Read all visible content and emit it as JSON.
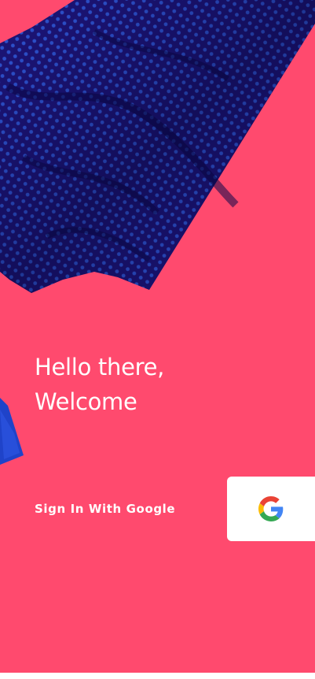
{
  "welcome": {
    "line1": "Hello there,",
    "line2": "Welcome"
  },
  "signin": {
    "label": "Sign In With Google"
  },
  "icons": {
    "google": "google-logo-icon"
  },
  "colors": {
    "background": "#ff4a6e",
    "fabric": "#1d1578",
    "dots": "#2f55d4",
    "text": "#ffffff",
    "google_blue": "#4285F4",
    "google_red": "#EA4335",
    "google_yellow": "#FBBC05",
    "google_green": "#34A853"
  }
}
